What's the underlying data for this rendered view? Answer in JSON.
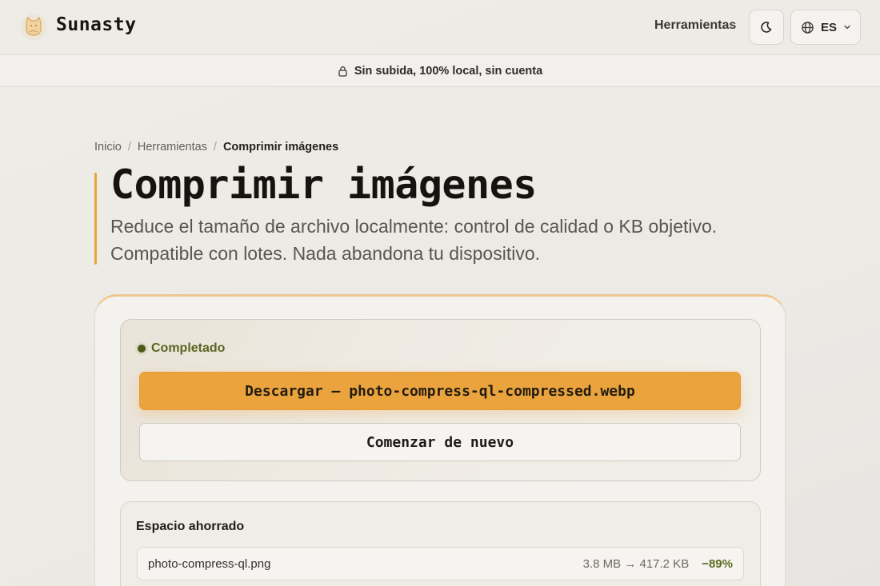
{
  "header": {
    "brand": "Sunasty",
    "nav_tools": "Herramientas",
    "theme_icon": "moon-icon",
    "lang_code": "ES"
  },
  "banner": {
    "text": "Sin subida, 100% local, sin cuenta",
    "icon": "lock-icon"
  },
  "breadcrumb": {
    "items": [
      "Inicio",
      "Herramientas",
      "Comprimir imágenes"
    ],
    "separator": "/"
  },
  "page": {
    "title": "Comprimir imágenes",
    "subtitle": "Reduce el tamaño de archivo localmente: control de calidad o KB objetivo. Compatible con lotes. Nada abandona tu dispositivo."
  },
  "result": {
    "status": "Completado",
    "download_label": "Descargar — photo-compress-ql-compressed.webp",
    "restart_label": "Comenzar de nuevo"
  },
  "savings": {
    "title": "Espacio ahorrado",
    "files": [
      {
        "name": "photo-compress-ql.png",
        "sizes": "3.8 MB → 417.2 KB",
        "percent": "−89%"
      }
    ]
  },
  "colors": {
    "accent": "#eba43d",
    "success": "#5a6520",
    "background": "#eceae5"
  }
}
